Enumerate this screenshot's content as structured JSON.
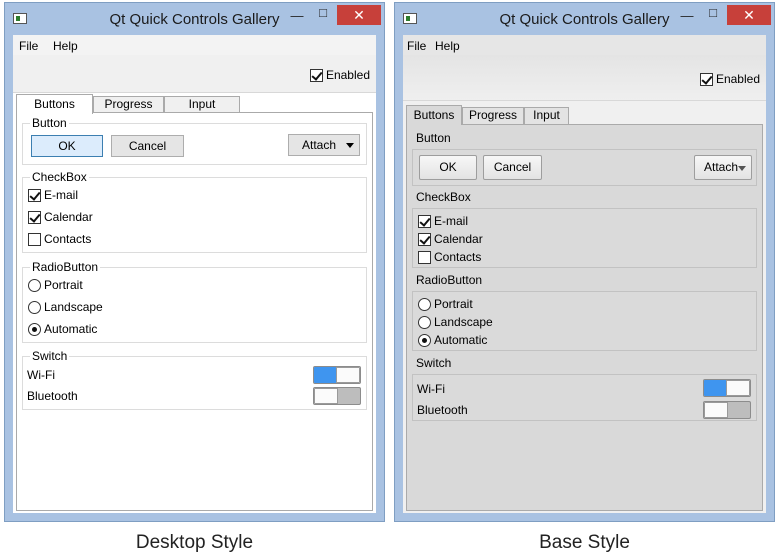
{
  "windows": [
    {
      "title": "Qt Quick Controls Gallery",
      "menu": [
        "File",
        "Help"
      ],
      "enabled_label": "Enabled",
      "enabled_checked": true,
      "tabs": [
        "Buttons",
        "Progress",
        "Input"
      ],
      "active_tab": 0,
      "groups": {
        "button": {
          "title": "Button",
          "ok": "OK",
          "cancel": "Cancel",
          "attach": "Attach"
        },
        "checkbox": {
          "title": "CheckBox",
          "items": [
            {
              "label": "E-mail",
              "checked": true
            },
            {
              "label": "Calendar",
              "checked": true
            },
            {
              "label": "Contacts",
              "checked": false
            }
          ]
        },
        "radio": {
          "title": "RadioButton",
          "items": [
            {
              "label": "Portrait",
              "selected": false
            },
            {
              "label": "Landscape",
              "selected": false
            },
            {
              "label": "Automatic",
              "selected": true
            }
          ]
        },
        "switch": {
          "title": "Switch",
          "items": [
            {
              "label": "Wi-Fi",
              "on": true
            },
            {
              "label": "Bluetooth",
              "on": false
            }
          ]
        }
      },
      "caption": "Desktop Style"
    },
    {
      "title": "Qt Quick Controls Gallery",
      "menu": [
        "File",
        "Help"
      ],
      "enabled_label": "Enabled",
      "enabled_checked": true,
      "tabs": [
        "Buttons",
        "Progress",
        "Input"
      ],
      "active_tab": 0,
      "groups": {
        "button": {
          "title": "Button",
          "ok": "OK",
          "cancel": "Cancel",
          "attach": "Attach"
        },
        "checkbox": {
          "title": "CheckBox",
          "items": [
            {
              "label": "E-mail",
              "checked": true
            },
            {
              "label": "Calendar",
              "checked": true
            },
            {
              "label": "Contacts",
              "checked": false
            }
          ]
        },
        "radio": {
          "title": "RadioButton",
          "items": [
            {
              "label": "Portrait",
              "selected": false
            },
            {
              "label": "Landscape",
              "selected": false
            },
            {
              "label": "Automatic",
              "selected": true
            }
          ]
        },
        "switch": {
          "title": "Switch",
          "items": [
            {
              "label": "Wi-Fi",
              "on": true
            },
            {
              "label": "Bluetooth",
              "on": false
            }
          ]
        }
      },
      "caption": "Base Style"
    }
  ],
  "icons": {
    "app": "app-window-icon",
    "minimize": "minimize-icon",
    "maximize": "maximize-icon",
    "close": "close-icon",
    "dropdown": "caret-down-icon"
  },
  "colors": {
    "frame": "#a9c2e2",
    "close": "#c7403a",
    "switch_on": "#3f95ef",
    "default_button": "#dcecfc"
  }
}
